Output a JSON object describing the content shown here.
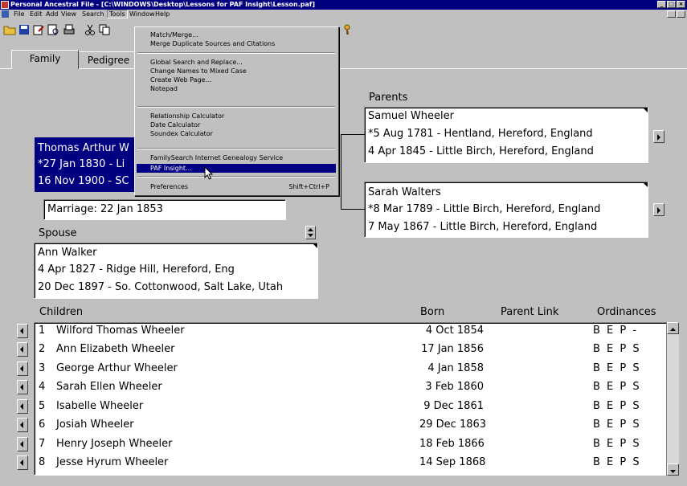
{
  "window": {
    "title": "Personal Ancestral File - [C:\\WINDOWS\\Desktop\\Lessons  for PAF Insight\\Lesson.paf]",
    "controls": [
      "_",
      "□",
      "×"
    ]
  },
  "menubar": {
    "items": [
      {
        "label": "File"
      },
      {
        "label": "Edit"
      },
      {
        "label": "Add"
      },
      {
        "label": "View"
      },
      {
        "label": "Search"
      },
      {
        "label": "Tools"
      },
      {
        "label": "Window"
      },
      {
        "label": "Help"
      }
    ]
  },
  "toolbar": {
    "icons": [
      "open-folder-icon",
      "save-icon",
      "edit-icon",
      "print-preview-icon",
      "print-icon",
      "scissors-icon",
      "copy-icon",
      "key-icon"
    ]
  },
  "tabs": [
    {
      "label": "Family"
    },
    {
      "label": "Pedigree"
    }
  ],
  "tools_menu": {
    "items": [
      {
        "label": "Match/Merge..."
      },
      {
        "label": "Merge Duplicate Sources and Citations"
      },
      {
        "label": "Global Search and Replace..."
      },
      {
        "label": "Change Names to Mixed Case"
      },
      {
        "label": "Create Web Page..."
      },
      {
        "label": "Notepad"
      },
      {
        "label": "Relationship Calculator"
      },
      {
        "label": "Date Calculator"
      },
      {
        "label": "Soundex Calculator"
      },
      {
        "label": "FamilySearch Internet Genealogy Service"
      },
      {
        "label": "PAF Insight..."
      },
      {
        "label": "Preferences",
        "shortcut": "Shift+Ctrl+P"
      }
    ]
  },
  "primary": {
    "line1": "Thomas Arthur W",
    "line2": "*27 Jan 1830 - Li",
    "line3": "16 Nov 1900 - SC"
  },
  "marriage": "Marriage: 22 Jan 1853",
  "parents": {
    "label": "Parents",
    "father": {
      "name": "Samuel Wheeler",
      "birth": "*5 Aug 1781 - Hentland, Hereford, England",
      "death": "4 Apr 1845 - Little Birch, Hereford, England"
    },
    "mother": {
      "name": "Sarah Walters",
      "birth": "*8 Mar 1789 - Little Birch, Hereford, England",
      "death": "7 May 1867 - Little Birch, Hereford, England"
    }
  },
  "spouse": {
    "label": "Spouse",
    "name": "Ann Walker",
    "birth": "4 Apr 1827 - Ridge Hill, Hereford, Eng",
    "death": "20 Dec 1897 - So. Cottonwood, Salt Lake, Utah"
  },
  "children": {
    "headers": {
      "children": "Children",
      "born": "Born",
      "parent_link": "Parent Link",
      "ordinances": "Ordinances"
    },
    "rows": [
      {
        "num": "1",
        "name": "Wilford Thomas Wheeler",
        "born": "4 Oct 1854",
        "ordinances": "B E P -"
      },
      {
        "num": "2",
        "name": "Ann Elizabeth Wheeler",
        "born": "17 Jan 1856",
        "ordinances": "B E P S"
      },
      {
        "num": "3",
        "name": "George Arthur Wheeler",
        "born": "4 Jan 1858",
        "ordinances": "B E P S"
      },
      {
        "num": "4",
        "name": "Sarah Ellen Wheeler",
        "born": "3 Feb 1860",
        "ordinances": "B E P S"
      },
      {
        "num": "5",
        "name": "Isabelle Wheeler",
        "born": "9 Dec 1861",
        "ordinances": "B E P S"
      },
      {
        "num": "6",
        "name": "Josiah Wheeler",
        "born": "29 Dec 1863",
        "ordinances": "B E P S"
      },
      {
        "num": "7",
        "name": "Henry Joseph Wheeler",
        "born": "18 Feb 1866",
        "ordinances": "B E P S"
      },
      {
        "num": "8",
        "name": "Jesse Hyrum Wheeler",
        "born": "14 Sep 1868",
        "ordinances": "B E P S"
      }
    ]
  }
}
